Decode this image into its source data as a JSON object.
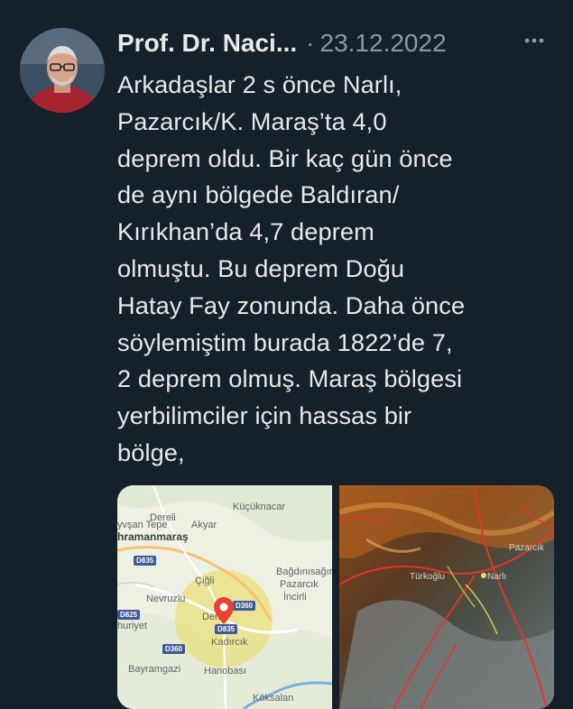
{
  "tweet": {
    "author": "Prof. Dr. Naci...",
    "separator": "·",
    "date": "23.12.2022",
    "more_icon": "more-horizontal-icon",
    "text": "Arkadaşlar 2 s önce Narlı,\nPazarcık/K. Maraş’ta 4,0\ndeprem oldu. Bir kaç gün önce\nde aynı bölgede Baldıran/\nKırıkhan’da 4,7 deprem\nolmuştu. Bu deprem Doğu\nHatay Fay zonunda. Daha önce\nsöylemiştim burada 1822’de 7,\n2 deprem olmuş. Maraş bölgesi\nyerbilimciler için hassas bir\nbölge,"
  },
  "map": {
    "labels": {
      "kucuknacar": "Küçüknacar",
      "dereli": "Dereli",
      "akyar": "Akyar",
      "tepe": "yvşan Tepe",
      "kahramanmaras": "hramanmaraş",
      "d835_a": "D835",
      "cigli": "Çiğli",
      "bagdinisagir": "Bağdınısağır",
      "pazarcik": "Pazarcık",
      "incirli": "İncirli",
      "d825": "D825",
      "nevruzlu": "Nevruzlu",
      "deri": "Deri",
      "d360_a": "D360",
      "d835_b": "D835",
      "huriyet": "huriyet",
      "kadirli": "Kadırcık",
      "d360_b": "D360",
      "bayramgazi": "Bayramgazi",
      "hanobasi": "Hanobası",
      "koksalan": "Köksalan"
    },
    "accent_circle": "#e8e07a",
    "pin_color": "#e94235"
  },
  "satellite": {
    "labels": {
      "pazarcik": "Pazarcık",
      "turkoglu": "Türkoğlu",
      "narli": "Narlı"
    },
    "fault_color": "#e0352b"
  }
}
